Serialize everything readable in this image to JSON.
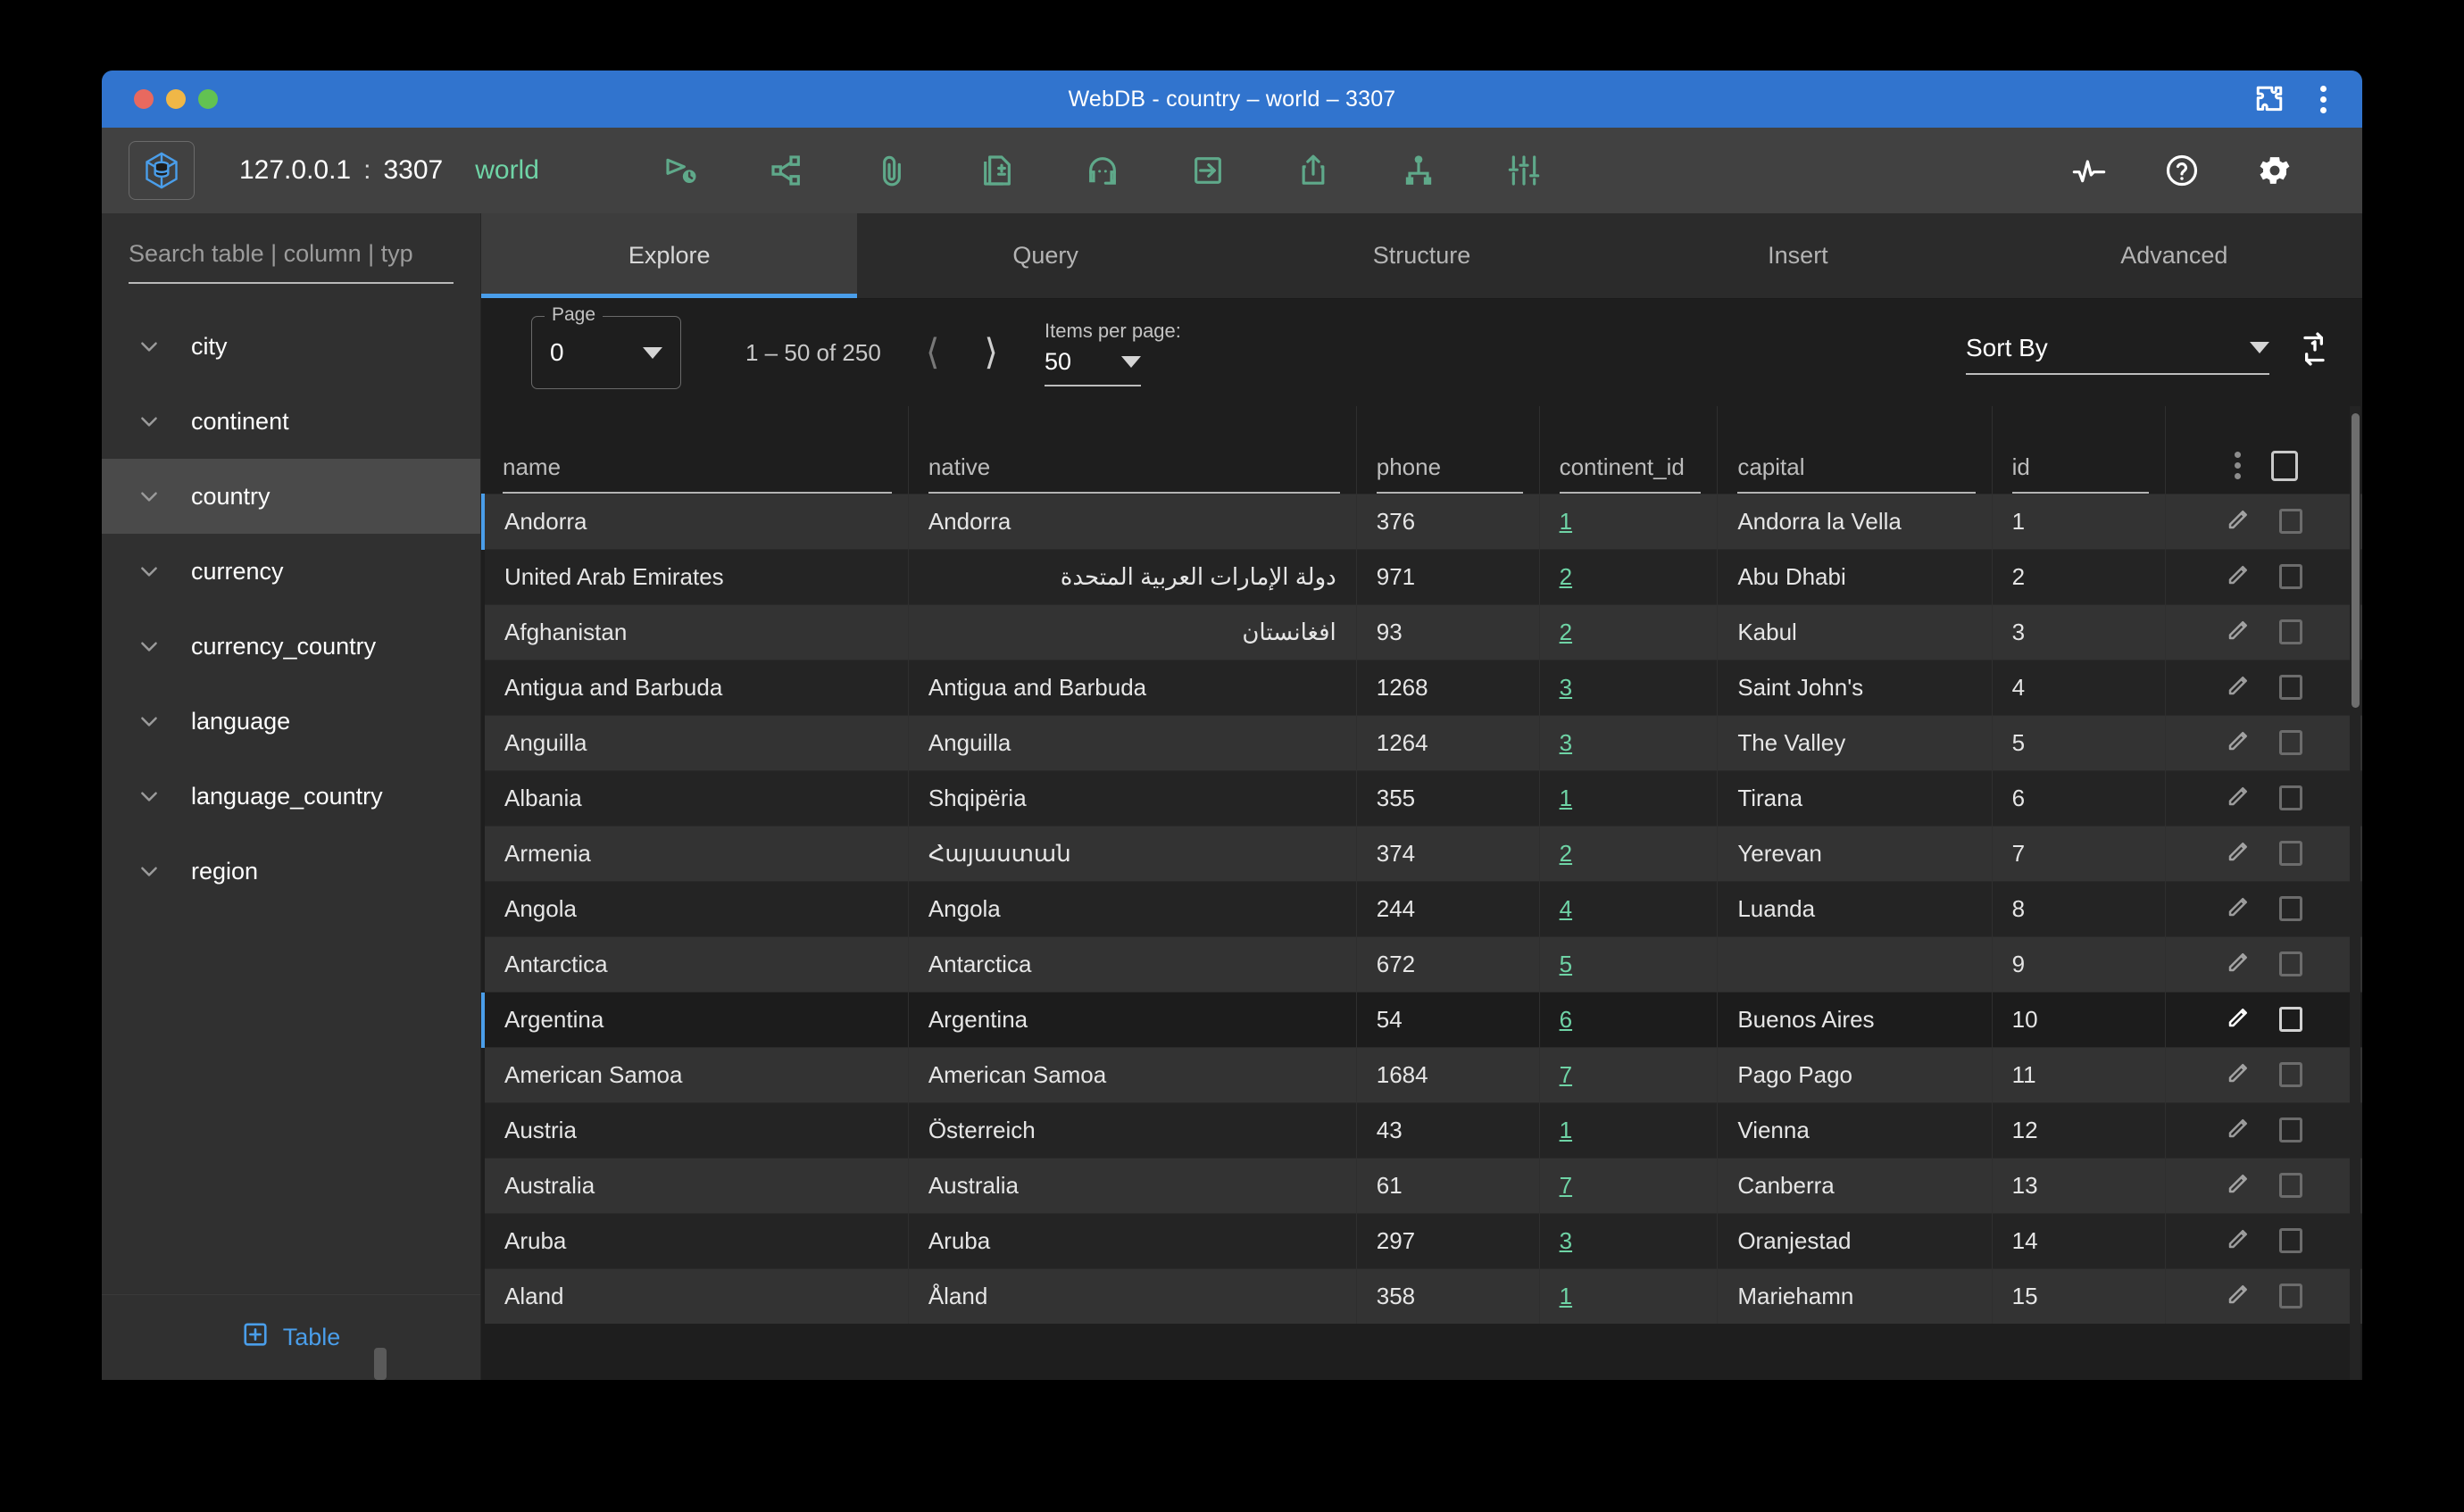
{
  "window": {
    "title": "WebDB - country – world – 3307",
    "extension_icon": "puzzle-icon",
    "menu_icon": "kebab-menu-icon"
  },
  "toolbar": {
    "logo_icon": "database-cube-icon",
    "host": "127.0.0.1",
    "separator": ":",
    "port": "3307",
    "database": "world",
    "database_color": "#6fd4a6",
    "actions": [
      {
        "name": "query-history-icon"
      },
      {
        "name": "share-graph-icon"
      },
      {
        "name": "attachment-icon"
      },
      {
        "name": "diff-document-icon"
      },
      {
        "name": "support-headset-icon"
      },
      {
        "name": "import-icon"
      },
      {
        "name": "export-icon"
      },
      {
        "name": "sitemap-icon"
      },
      {
        "name": "settings-sliders-icon"
      }
    ],
    "right_actions": [
      {
        "name": "activity-pulse-icon"
      },
      {
        "name": "help-circle-icon"
      },
      {
        "name": "gear-icon"
      }
    ]
  },
  "sidebar": {
    "search_placeholder": "Search table | column | typ",
    "search_value": "",
    "items": [
      {
        "label": "city",
        "selected": false
      },
      {
        "label": "continent",
        "selected": false
      },
      {
        "label": "country",
        "selected": true
      },
      {
        "label": "currency",
        "selected": false
      },
      {
        "label": "currency_country",
        "selected": false
      },
      {
        "label": "language",
        "selected": false
      },
      {
        "label": "language_country",
        "selected": false
      },
      {
        "label": "region",
        "selected": false
      }
    ],
    "add_table_label": "Table",
    "add_table_icon": "add-box-icon"
  },
  "tabs": [
    {
      "label": "Explore",
      "active": true
    },
    {
      "label": "Query",
      "active": false
    },
    {
      "label": "Structure",
      "active": false
    },
    {
      "label": "Insert",
      "active": false
    },
    {
      "label": "Advanced",
      "active": false
    }
  ],
  "pagination": {
    "page_label": "Page",
    "page_value": "0",
    "range_text": "1 – 50 of 250",
    "prev_icon": "chevron-left-icon",
    "next_icon": "chevron-right-icon",
    "items_per_page_label": "Items per page:",
    "items_per_page_value": "50"
  },
  "sort": {
    "label": "Sort By",
    "refresh_icon": "repeat-one-icon"
  },
  "table": {
    "columns": [
      "name",
      "native",
      "phone",
      "continent_id",
      "capital",
      "id"
    ],
    "actions_kebab_icon": "vertical-kebab-icon",
    "select_all_icon": "checkbox-unchecked-icon",
    "row_edit_icon": "pencil-icon",
    "row_select_icon": "checkbox-unchecked-icon",
    "rows": [
      {
        "name": "Andorra",
        "native": "Andorra",
        "phone": "376",
        "continent_id": "1",
        "capital": "Andorra la Vella",
        "id": "1",
        "rtl": false,
        "hovered": false
      },
      {
        "name": "United Arab Emirates",
        "native": "دولة الإمارات العربية المتحدة",
        "phone": "971",
        "continent_id": "2",
        "capital": "Abu Dhabi",
        "id": "2",
        "rtl": true,
        "hovered": false
      },
      {
        "name": "Afghanistan",
        "native": "افغانستان",
        "phone": "93",
        "continent_id": "2",
        "capital": "Kabul",
        "id": "3",
        "rtl": true,
        "hovered": false
      },
      {
        "name": "Antigua and Barbuda",
        "native": "Antigua and Barbuda",
        "phone": "1268",
        "continent_id": "3",
        "capital": "Saint John's",
        "id": "4",
        "rtl": false,
        "hovered": false
      },
      {
        "name": "Anguilla",
        "native": "Anguilla",
        "phone": "1264",
        "continent_id": "3",
        "capital": "The Valley",
        "id": "5",
        "rtl": false,
        "hovered": false
      },
      {
        "name": "Albania",
        "native": "Shqipëria",
        "phone": "355",
        "continent_id": "1",
        "capital": "Tirana",
        "id": "6",
        "rtl": false,
        "hovered": false
      },
      {
        "name": "Armenia",
        "native": "Հայաստան",
        "phone": "374",
        "continent_id": "2",
        "capital": "Yerevan",
        "id": "7",
        "rtl": false,
        "hovered": false
      },
      {
        "name": "Angola",
        "native": "Angola",
        "phone": "244",
        "continent_id": "4",
        "capital": "Luanda",
        "id": "8",
        "rtl": false,
        "hovered": false
      },
      {
        "name": "Antarctica",
        "native": "Antarctica",
        "phone": "672",
        "continent_id": "5",
        "capital": "",
        "id": "9",
        "rtl": false,
        "hovered": false
      },
      {
        "name": "Argentina",
        "native": "Argentina",
        "phone": "54",
        "continent_id": "6",
        "capital": "Buenos Aires",
        "id": "10",
        "rtl": false,
        "hovered": true
      },
      {
        "name": "American Samoa",
        "native": "American Samoa",
        "phone": "1684",
        "continent_id": "7",
        "capital": "Pago Pago",
        "id": "11",
        "rtl": false,
        "hovered": false
      },
      {
        "name": "Austria",
        "native": "Österreich",
        "phone": "43",
        "continent_id": "1",
        "capital": "Vienna",
        "id": "12",
        "rtl": false,
        "hovered": false
      },
      {
        "name": "Australia",
        "native": "Australia",
        "phone": "61",
        "continent_id": "7",
        "capital": "Canberra",
        "id": "13",
        "rtl": false,
        "hovered": false
      },
      {
        "name": "Aruba",
        "native": "Aruba",
        "phone": "297",
        "continent_id": "3",
        "capital": "Oranjestad",
        "id": "14",
        "rtl": false,
        "hovered": false
      },
      {
        "name": "Aland",
        "native": "Åland",
        "phone": "358",
        "continent_id": "1",
        "capital": "Mariehamn",
        "id": "15",
        "rtl": false,
        "hovered": false
      }
    ]
  },
  "colors": {
    "titlebar": "#3174ce",
    "accent": "#4a9eea",
    "link_green": "#6fd4a6",
    "toolbar_icon": "#5fa98a"
  }
}
